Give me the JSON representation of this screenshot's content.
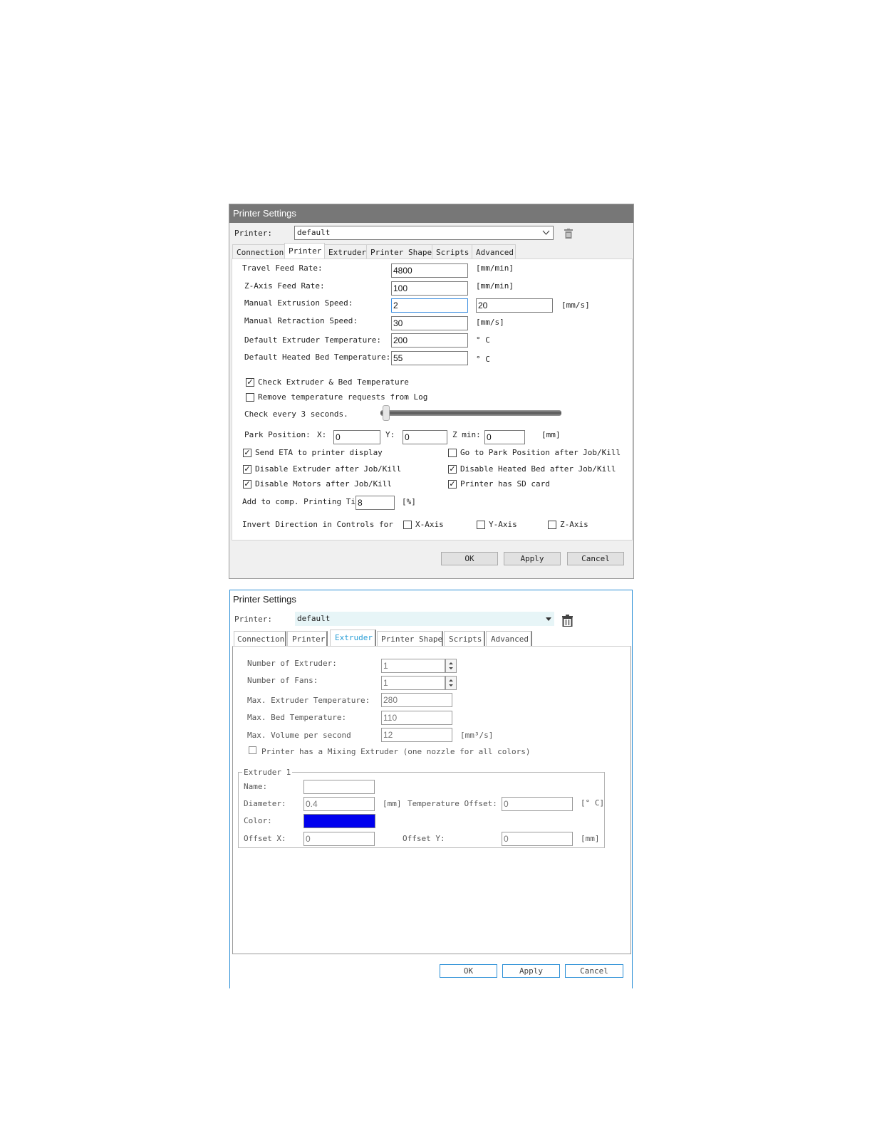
{
  "dialog1": {
    "title": "Printer Settings",
    "printer_label": "Printer:",
    "printer_value": "default",
    "tabs": [
      "Connection",
      "Printer",
      "Extruder",
      "Printer Shape",
      "Scripts",
      "Advanced"
    ],
    "active_tab": "Printer",
    "fields": {
      "travel_label": "Travel Feed Rate:",
      "travel_value": "4800",
      "travel_unit": "[mm/min]",
      "zaxis_label": "Z-Axis Feed Rate:",
      "zaxis_value": "100",
      "zaxis_unit": "[mm/min]",
      "mext_label": "Manual Extrusion Speed:",
      "mext_value": "2",
      "mext_value2": "20",
      "mext_unit": "[mm/s]",
      "mret_label": "Manual Retraction Speed:",
      "mret_value": "30",
      "mret_unit": "[mm/s]",
      "ext_temp_label": "Default Extruder Temperature:",
      "ext_temp_value": "200",
      "ext_temp_unit": "° C",
      "bed_temp_label": "Default Heated Bed Temperature:",
      "bed_temp_value": "55",
      "bed_temp_unit": "° C"
    },
    "check_temp_label": "Check Extruder & Bed Temperature",
    "remove_log_label": "Remove temperature requests from Log",
    "check_every_label": "Check every 3 seconds.",
    "slider_value_seconds": 3,
    "park": {
      "label": "Park Position:",
      "x_label": "X:",
      "x_value": "0",
      "y_label": "Y:",
      "y_value": "0",
      "zmin_label": "Z min:",
      "zmin_value": "0",
      "unit": "[mm]"
    },
    "checks": {
      "send_eta": "Send ETA to printer display",
      "goto_park": "Go to Park Position after Job/Kill",
      "disable_extruder": "Disable Extruder after Job/Kill",
      "disable_bed": "Disable Heated Bed after Job/Kill",
      "disable_motors": "Disable Motors after Job/Kill",
      "has_sd": "Printer has SD card"
    },
    "add_time_label": "Add to comp. Printing Time",
    "add_time_value": "8",
    "add_time_unit": "[%]",
    "invert_label": "Invert Direction in Controls for",
    "xaxis_label": "X-Axis",
    "yaxis_label": "Y-Axis",
    "zaxis_label": "Z-Axis",
    "ok": "OK",
    "apply": "Apply",
    "cancel": "Cancel"
  },
  "dialog2": {
    "title": "Printer Settings",
    "printer_label": "Printer:",
    "printer_value": "default",
    "tabs": [
      "Connection",
      "Printer",
      "Extruder",
      "Printer Shape",
      "Scripts",
      "Advanced"
    ],
    "active_tab": "Extruder",
    "num_extruder_label": "Number of Extruder:",
    "num_extruder_value": "1",
    "num_fans_label": "Number of Fans:",
    "num_fans_value": "1",
    "max_ext_temp_label": "Max. Extruder Temperature:",
    "max_ext_temp_value": "280",
    "max_bed_temp_label": "Max. Bed Temperature:",
    "max_bed_temp_value": "110",
    "max_vol_label": "Max. Volume per second",
    "max_vol_value": "12",
    "max_vol_unit": "[mm³/s]",
    "mixing_label": "Printer has a Mixing Extruder (one nozzle for all colors)",
    "group_label": "Extruder 1",
    "name_label": "Name:",
    "name_value": "",
    "diameter_label": "Diameter:",
    "diameter_value": "0.4",
    "diameter_unit": "[mm]",
    "temp_offset_label": "Temperature Offset:",
    "temp_offset_value": "0",
    "temp_offset_unit": "[° C]",
    "color_label": "Color:",
    "color_value": "#0000ee",
    "offset_x_label": "Offset X:",
    "offset_x_value": "0",
    "offset_y_label": "Offset Y:",
    "offset_y_value": "0",
    "offset_unit": "[mm]",
    "ok": "OK",
    "apply": "Apply",
    "cancel": "Cancel"
  },
  "colors": {
    "titlebar": "#777777",
    "accent": "#2b8fd6",
    "focus": "#3c8ee0"
  }
}
